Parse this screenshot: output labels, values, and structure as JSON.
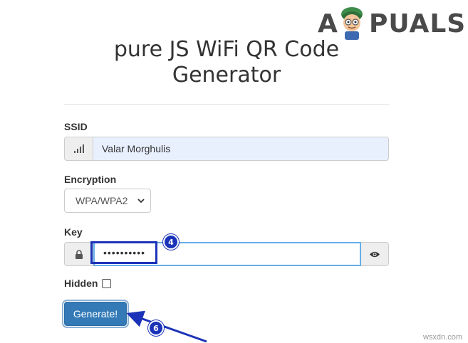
{
  "logo": {
    "text_left": "A",
    "text_right": "PUALS"
  },
  "form": {
    "title_line1": "pure JS WiFi QR Code",
    "title_line2": "Generator",
    "ssid": {
      "label": "SSID",
      "value": "Valar Morghulis",
      "icon": "signal-bars-icon"
    },
    "encryption": {
      "label": "Encryption",
      "selected": "WPA/WPA2"
    },
    "key": {
      "label": "Key",
      "value": "••••••••••",
      "icon": "lock-icon",
      "toggle_icon": "eye-icon"
    },
    "hidden": {
      "label": "Hidden",
      "checked": false
    },
    "submit_label": "Generate!"
  },
  "annotations": {
    "step_badge_key": "4",
    "step_badge_button": "6",
    "highlight_color": "#1b33b8"
  },
  "watermark": "wsxdn.com",
  "colors": {
    "primary_button": "#337ab7",
    "focus_border": "#66afe9",
    "autofill_bg": "#e8f0fe"
  }
}
